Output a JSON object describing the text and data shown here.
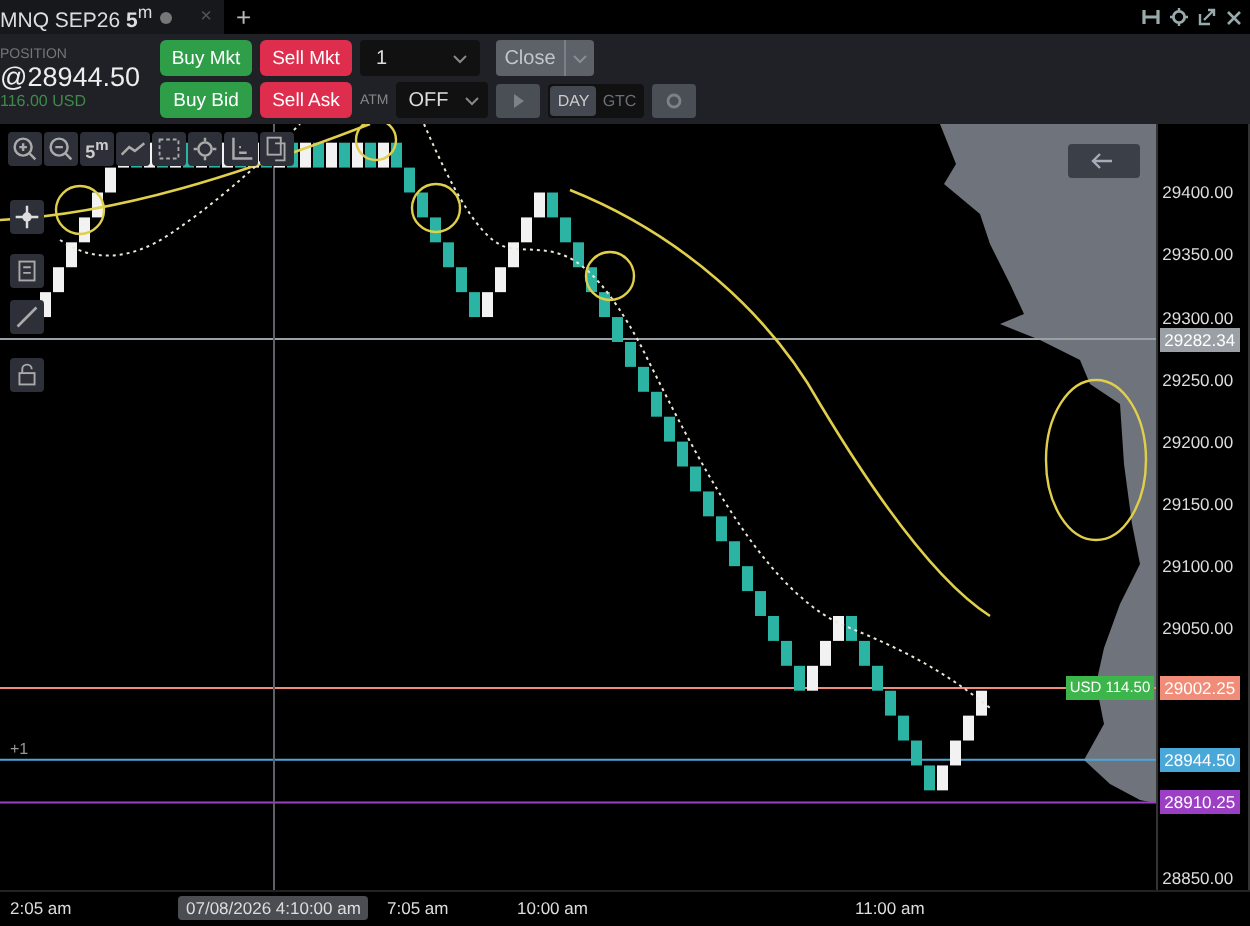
{
  "tab": {
    "title": "MNQ SEP26 **5**$^{m}$",
    "close": "×",
    "add": "+"
  },
  "position": {
    "label": "POSITION",
    "price": "@28944.50",
    "pnl": "116.00 USD"
  },
  "order_rows": [
    [
      {
        "label": "Buy Mkt",
        "kind": "buy"
      },
      {
        "label": "Sell Mkt",
        "kind": "sell"
      }
    ],
    [
      {
        "label": "Buy Bid",
        "kind": "buy"
      },
      {
        "label": "Sell Ask",
        "kind": "sell"
      }
    ]
  ],
  "quantity": "1",
  "close_button": {
    "label": "Close",
    "disabled": true
  },
  "atm": {
    "label": "ATM",
    "value": "OFF"
  },
  "tif": [
    {
      "label": "DAY",
      "selected": true
    },
    {
      "label": "GTC",
      "selected": false
    }
  ],
  "timeframe": "5$^{m}$",
  "offset_label": "+1",
  "position_tag": "USD 114.50",
  "time_axis": [
    "2:05 am",
    "7:05 am",
    "10:00 am",
    "11:00 am"
  ],
  "price_axis": [
    "29400.00",
    "29350.00",
    "29300.00",
    "29250.00",
    "29200.00",
    "29150.00",
    "29100.00",
    "29050.00",
    "28850.00"
  ],
  "price_markers": [
    {
      "label": "29282.34",
      "color": "#9aa0a6"
    },
    {
      "label": "29002.25",
      "color": "#f08c78"
    },
    {
      "label": "28944.50",
      "color": "#4aa8d8"
    },
    {
      "label": "28910.25",
      "color": "#9c3fc4"
    }
  ],
  "crosshair_label": "07/08/2026 4:10:00 am"
}
